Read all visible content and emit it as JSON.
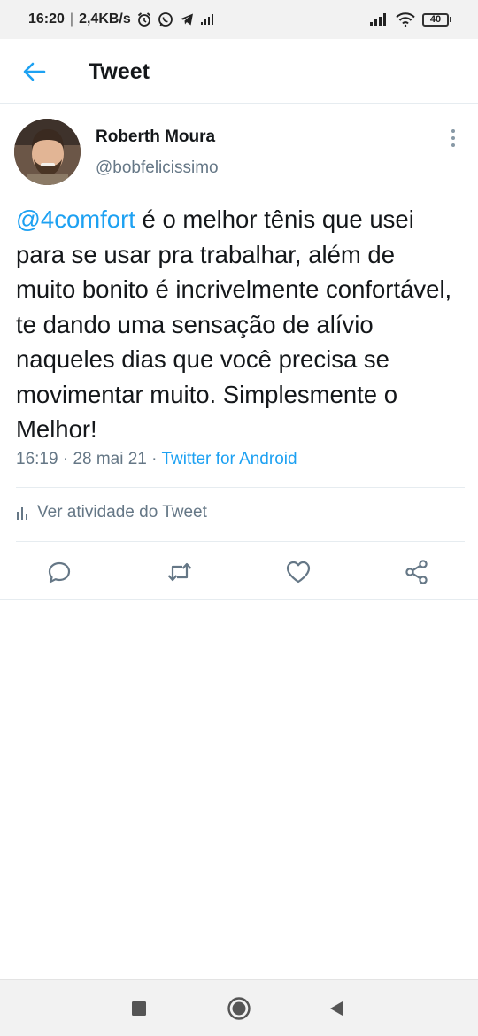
{
  "status_bar": {
    "time": "16:20",
    "network_speed": "2,4KB/s",
    "battery_level": "40",
    "icons": [
      "alarm-icon",
      "whatsapp-icon",
      "telegram-icon",
      "data-icon",
      "signal-icon",
      "wifi-icon",
      "battery-icon"
    ]
  },
  "header": {
    "title": "Tweet",
    "back_icon": "arrow-left-icon"
  },
  "tweet": {
    "author_name": "Roberth Moura",
    "author_handle": "@bobfelicissimo",
    "mention": "@4comfort",
    "text_rest": " é o melhor tênis que usei para se usar pra trabalhar, além de muito bonito é incrivelmente confortável, te dando uma sensação de alívio naqueles dias que você precisa se movimentar muito. Simplesmente o Melhor!",
    "time": "16:19",
    "date": "28 mai 21",
    "separator": " · ",
    "source": "Twitter for Android",
    "activity_label": "Ver atividade do Tweet"
  },
  "actions": {
    "icons": [
      "reply-icon",
      "retweet-icon",
      "like-icon",
      "share-icon"
    ]
  },
  "colors": {
    "accent": "#1da1f2",
    "secondary_text": "#657786",
    "primary_text": "#14171a",
    "divider": "#e6ecf0"
  },
  "nav_bar": {
    "icons": [
      "recent-apps-icon",
      "home-icon",
      "back-icon"
    ]
  }
}
